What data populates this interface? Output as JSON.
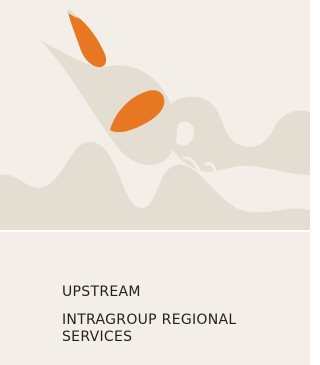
{
  "card": {
    "category_label": "UPSTREAM",
    "title": "INTRAGROUP REGIONAL SERVICES",
    "colors": {
      "background": "#f3efe8",
      "illustration": "#e4ddd2",
      "accent": "#e87722"
    },
    "illustration_icon": "abstract-illustration-icon"
  }
}
